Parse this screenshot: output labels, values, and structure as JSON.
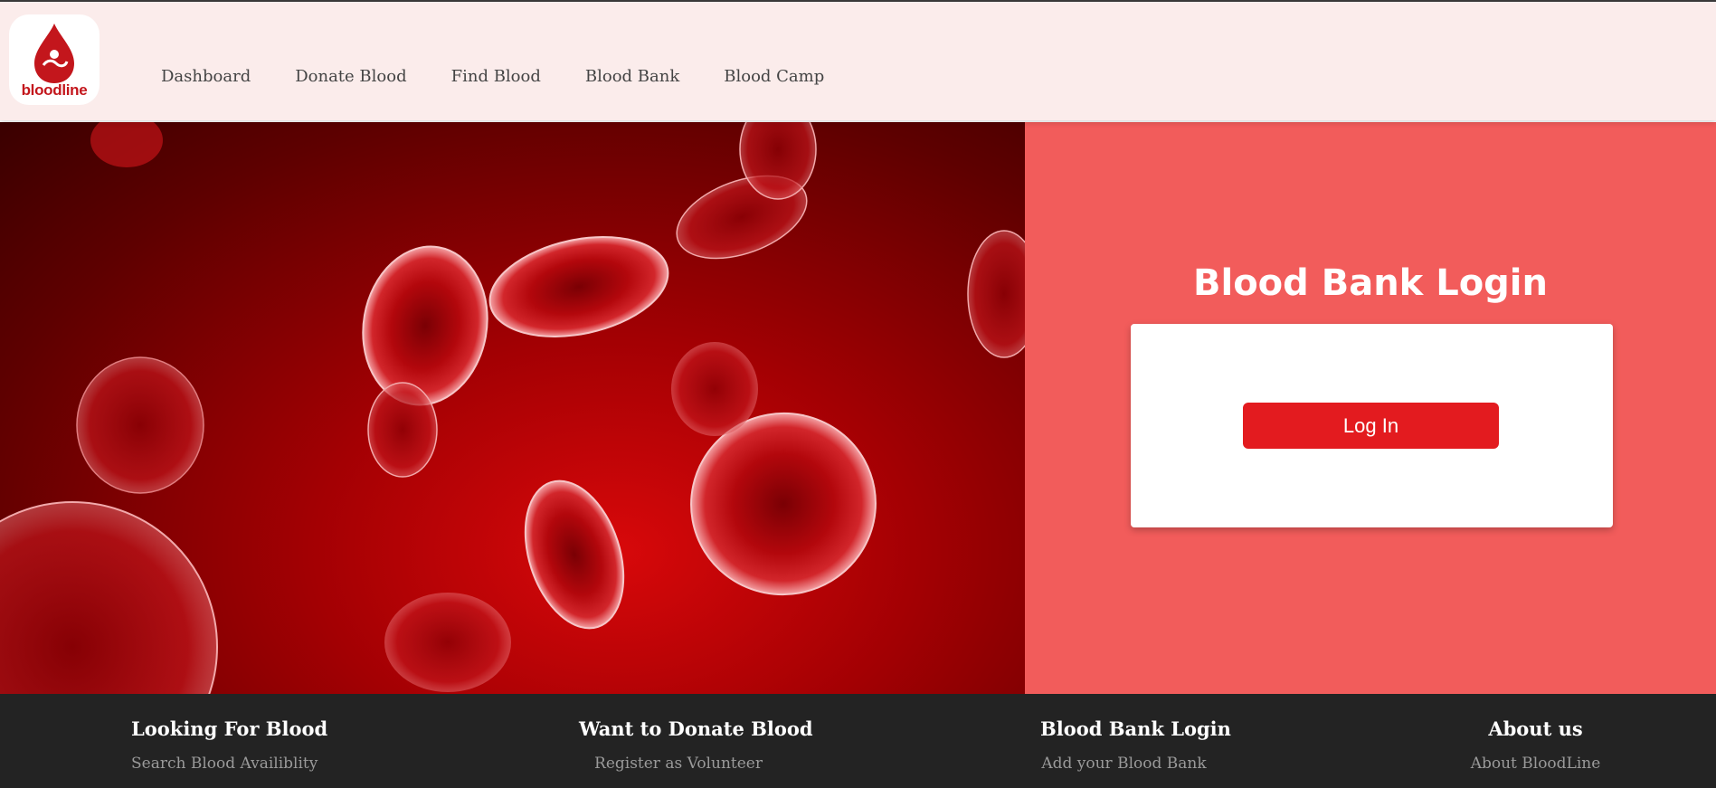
{
  "brand": {
    "logo_text": "bloodline"
  },
  "nav": {
    "items": [
      {
        "label": "Dashboard"
      },
      {
        "label": "Donate Blood"
      },
      {
        "label": "Find Blood"
      },
      {
        "label": "Blood Bank"
      },
      {
        "label": "Blood Camp"
      }
    ]
  },
  "login": {
    "title": "Blood Bank Login",
    "button_label": "Log In"
  },
  "footer": {
    "columns": [
      {
        "heading": "Looking For Blood",
        "link": "Search Blood Availiblity"
      },
      {
        "heading": "Want to Donate Blood",
        "link": "Register as Volunteer"
      },
      {
        "heading": "Blood Bank Login",
        "link": "Add your Blood Bank"
      },
      {
        "heading": "About us",
        "link": "About BloodLine"
      }
    ]
  },
  "colors": {
    "navbar_bg": "#fbeceb",
    "login_panel_bg": "#f25c5b",
    "login_button": "#e31b1f",
    "footer_bg": "#232323"
  }
}
